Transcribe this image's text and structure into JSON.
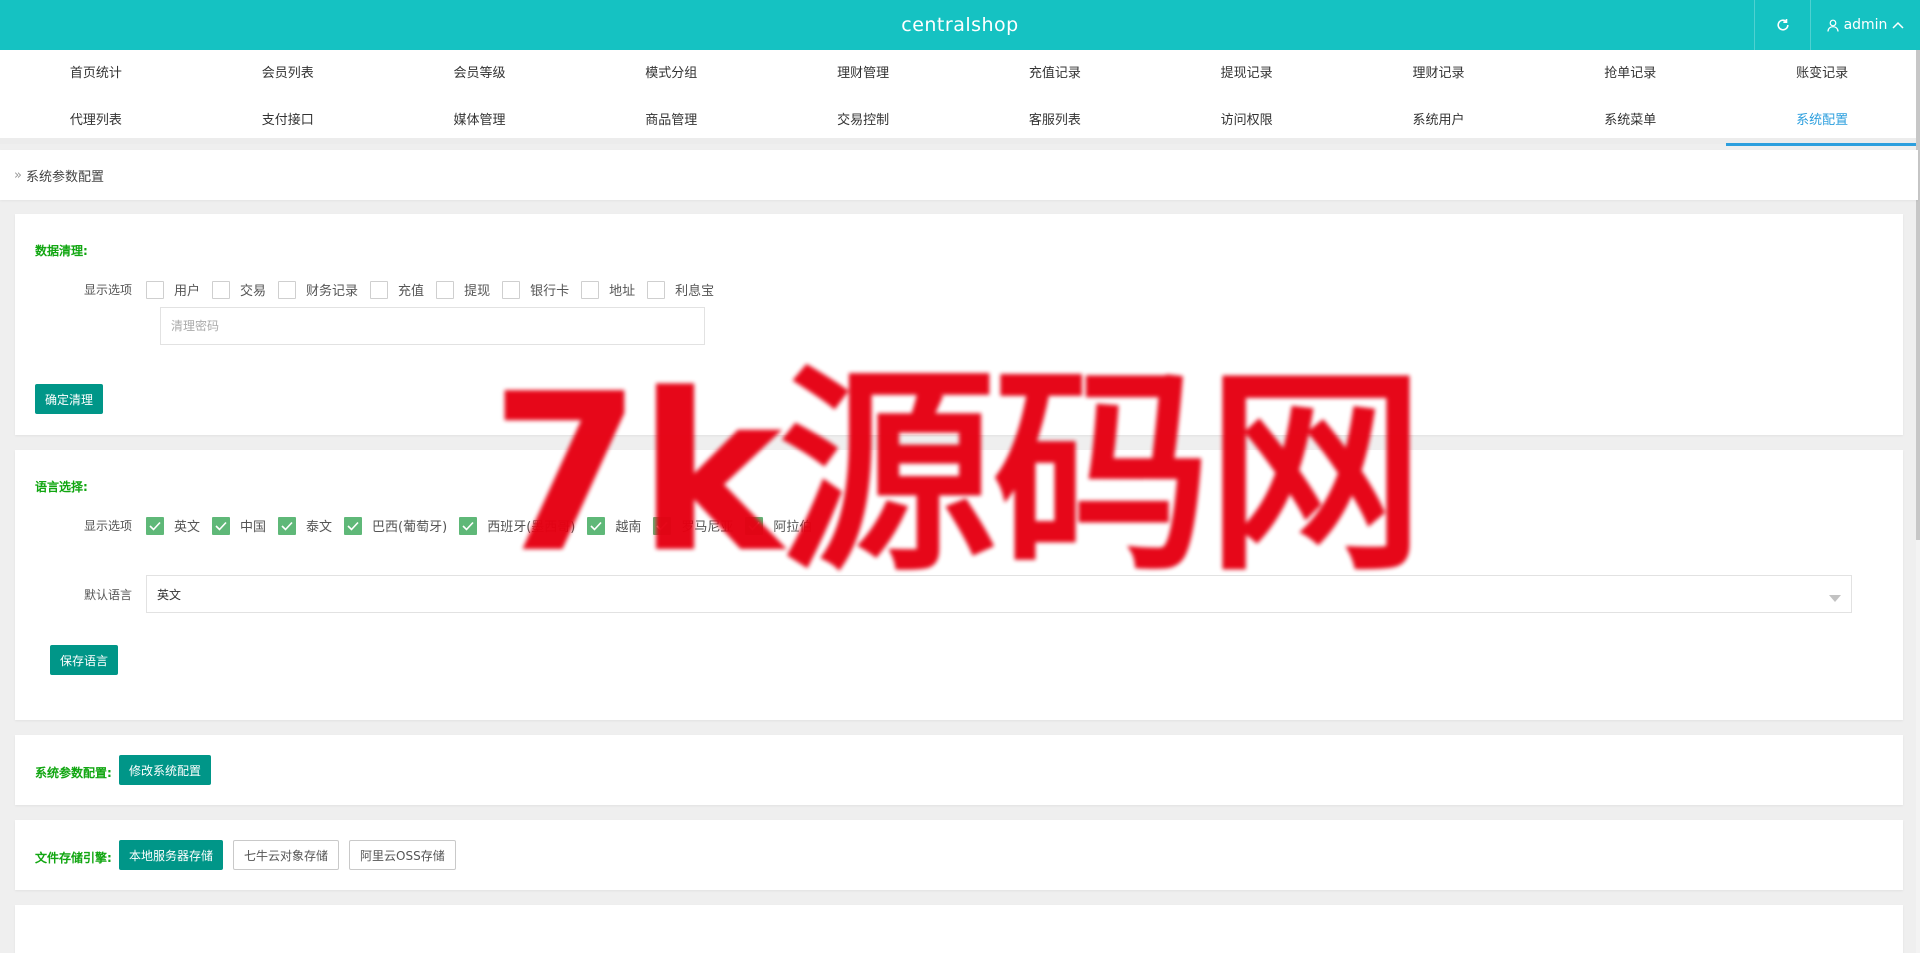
{
  "app": {
    "title": "centralshop",
    "user_label": "admin"
  },
  "nav": {
    "row1": [
      "首页统计",
      "会员列表",
      "会员等级",
      "模式分组",
      "理财管理",
      "充值记录",
      "提现记录",
      "理财记录",
      "抢单记录",
      "账变记录"
    ],
    "row2": [
      "代理列表",
      "支付接口",
      "媒体管理",
      "商品管理",
      "交易控制",
      "客服列表",
      "访问权限",
      "系统用户",
      "系统菜单",
      "系统配置"
    ],
    "active": "系统配置"
  },
  "breadcrumb": {
    "current": "系统参数配置"
  },
  "data_clean": {
    "title": "数据清理:",
    "options_label": "显示选项",
    "options": [
      "用户",
      "交易",
      "财务记录",
      "充值",
      "提现",
      "银行卡",
      "地址",
      "利息宝"
    ],
    "password_placeholder": "清理密码",
    "confirm_button": "确定清理"
  },
  "language": {
    "title": "语言选择:",
    "options_label": "显示选项",
    "options": [
      "英文",
      "中国",
      "泰文",
      "巴西(葡萄牙)",
      "西班牙(墨西哥)",
      "越南",
      "罗马尼亚",
      "阿拉伯"
    ],
    "default_label": "默认语言",
    "default_value": "英文",
    "save_button": "保存语言"
  },
  "sys_config": {
    "title": "系统参数配置:",
    "edit_button": "修改系统配置"
  },
  "storage": {
    "title": "文件存储引擎:",
    "options": [
      "本地服务器存储",
      "七牛云对象存储",
      "阿里云OSS存储"
    ],
    "selected": "本地服务器存储"
  },
  "watermark": {
    "text": "7k源码网"
  },
  "colors": {
    "topbar": "#15c2c2",
    "primary_button": "#009688",
    "section_title": "#11a611",
    "checkbox_checked": "#5fb878",
    "nav_active": "#2d9fde",
    "watermark": "#e60012"
  }
}
